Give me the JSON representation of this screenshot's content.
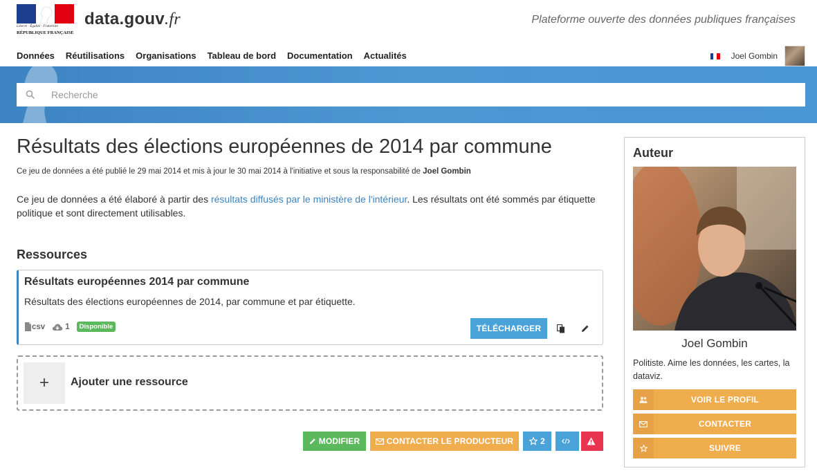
{
  "header": {
    "logo_motto": "Liberté · Égalité · Fraternité",
    "logo_name": "RÉPUBLIQUE FRANÇAISE",
    "site_name": "data.gouv",
    "site_tld": ".fr",
    "tagline": "Plateforme ouverte des données publiques françaises",
    "nav": [
      "Données",
      "Réutilisations",
      "Organisations",
      "Tableau de bord",
      "Documentation",
      "Actualités"
    ],
    "user_name": "Joel Gombin"
  },
  "search": {
    "placeholder": "Recherche"
  },
  "dataset": {
    "title": "Résultats des élections européennes de 2014 par commune",
    "pub_text": "Ce jeu de données a été publié le 29 mai 2014 et mis à jour le 30 mai 2014 à l'initiative et sous la responsabilité de ",
    "pub_author": "Joel Gombin",
    "desc_before": "Ce jeu de données a été élaboré à partir des ",
    "desc_link": "résultats diffusés par le ministère de l'intérieur",
    "desc_after": ". Les résultats ont été sommés par étiquette politique et sont directement utilisables."
  },
  "resources": {
    "heading": "Ressources",
    "items": [
      {
        "title": "Résultats européennes 2014 par commune",
        "description": "Résultats des élections européennes de 2014, par commune et par étiquette.",
        "format": "csv",
        "downloads": "1",
        "status": "Disponible",
        "download_label": "TÉLÉCHARGER"
      }
    ],
    "add_label": "Ajouter une ressource",
    "add_symbol": "+"
  },
  "actions": {
    "edit": "MODIFIER",
    "contact": "CONTACTER LE PRODUCTEUR",
    "stars": "2"
  },
  "author": {
    "heading": "Auteur",
    "name": "Joel Gombin",
    "bio": "Politiste. Aime les données, les cartes, la dataviz.",
    "buttons": [
      "VOIR LE PROFIL",
      "CONTACTER",
      "SUIVRE"
    ]
  },
  "colors": {
    "brand_blue": "#3c84c2",
    "green": "#5cb85c",
    "orange": "#f0ad4e",
    "info": "#4aa3d8",
    "danger": "#e8344e"
  }
}
